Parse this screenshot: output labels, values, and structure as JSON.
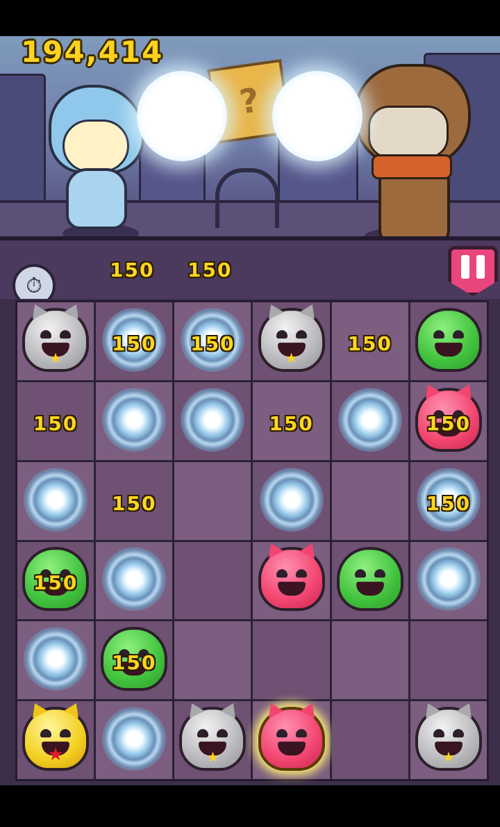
{
  "hud": {
    "score": "194,414",
    "top_points": [
      "150",
      "150"
    ]
  },
  "board": {
    "rows": [
      [
        {
          "type": "gray-monster",
          "points": ""
        },
        {
          "type": "spark",
          "points": "150"
        },
        {
          "type": "spark",
          "points": "150"
        },
        {
          "type": "gray-monster",
          "points": ""
        },
        {
          "type": "empty",
          "points": "150"
        },
        {
          "type": "green-monster",
          "points": ""
        }
      ],
      [
        {
          "type": "empty",
          "points": "150"
        },
        {
          "type": "spark",
          "points": ""
        },
        {
          "type": "spark",
          "points": ""
        },
        {
          "type": "empty",
          "points": "150"
        },
        {
          "type": "spark",
          "points": ""
        },
        {
          "type": "pink-monster",
          "points": "150"
        }
      ],
      [
        {
          "type": "spark",
          "points": ""
        },
        {
          "type": "empty",
          "points": "150"
        },
        {
          "type": "empty",
          "points": ""
        },
        {
          "type": "spark",
          "points": ""
        },
        {
          "type": "empty",
          "points": ""
        },
        {
          "type": "spark",
          "points": "150"
        }
      ],
      [
        {
          "type": "green-monster",
          "points": "150"
        },
        {
          "type": "spark",
          "points": ""
        },
        {
          "type": "empty",
          "points": ""
        },
        {
          "type": "pink-monster",
          "points": ""
        },
        {
          "type": "green-monster",
          "points": ""
        },
        {
          "type": "spark",
          "points": ""
        }
      ],
      [
        {
          "type": "spark",
          "points": ""
        },
        {
          "type": "green-monster",
          "points": "150"
        },
        {
          "type": "empty",
          "points": ""
        },
        {
          "type": "empty",
          "points": ""
        },
        {
          "type": "empty",
          "points": ""
        },
        {
          "type": "empty",
          "points": ""
        }
      ],
      [
        {
          "type": "gold-monster",
          "points": ""
        },
        {
          "type": "spark",
          "points": ""
        },
        {
          "type": "gray-monster",
          "points": ""
        },
        {
          "type": "pink-monster-selected",
          "points": ""
        },
        {
          "type": "empty",
          "points": ""
        },
        {
          "type": "gray-monster",
          "points": ""
        }
      ]
    ]
  },
  "icons": {
    "timer": "stopwatch-icon",
    "pause": "pause-icon"
  }
}
